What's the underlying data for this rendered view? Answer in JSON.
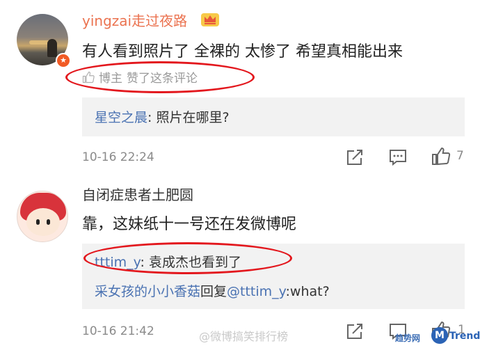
{
  "comments": [
    {
      "username": "yingzai走过夜路",
      "text": "有人看到照片了 全裸的 太惨了 希望真相能出来",
      "liked_by_label": "博主",
      "liked_suffix": "赞了这条评论",
      "reply": {
        "user": "星空之晨",
        "text": ": 照片在哪里?"
      },
      "time": "10-16 22:24",
      "like_count": "7",
      "icons": [
        "share-icon",
        "comment-icon",
        "thumbs-up-icon"
      ]
    },
    {
      "username": "自闭症患者土肥圆",
      "text": "靠，这妹纸十一号还在发微博呢",
      "replies": [
        {
          "user": "tttim_y",
          "text": ": 袁成杰也看到了"
        },
        {
          "user": "采女孩的小小香菇",
          "middle": "回复",
          "mention": "@tttim_y",
          "text": ":what?"
        }
      ],
      "time": "10-16 21:42",
      "like_count": "1",
      "icons": [
        "share-icon",
        "comment-icon",
        "thumbs-up-icon"
      ]
    }
  ],
  "watermark": "@微博搞笑排行榜",
  "logo": {
    "part1": "趋势网",
    "mark": "M",
    "part2": "Trend"
  },
  "colors": {
    "username_accent": "#eb7350",
    "link_blue": "#4a72b2",
    "highlight_red": "#e3171d",
    "badge_orange": "#f15a24"
  }
}
